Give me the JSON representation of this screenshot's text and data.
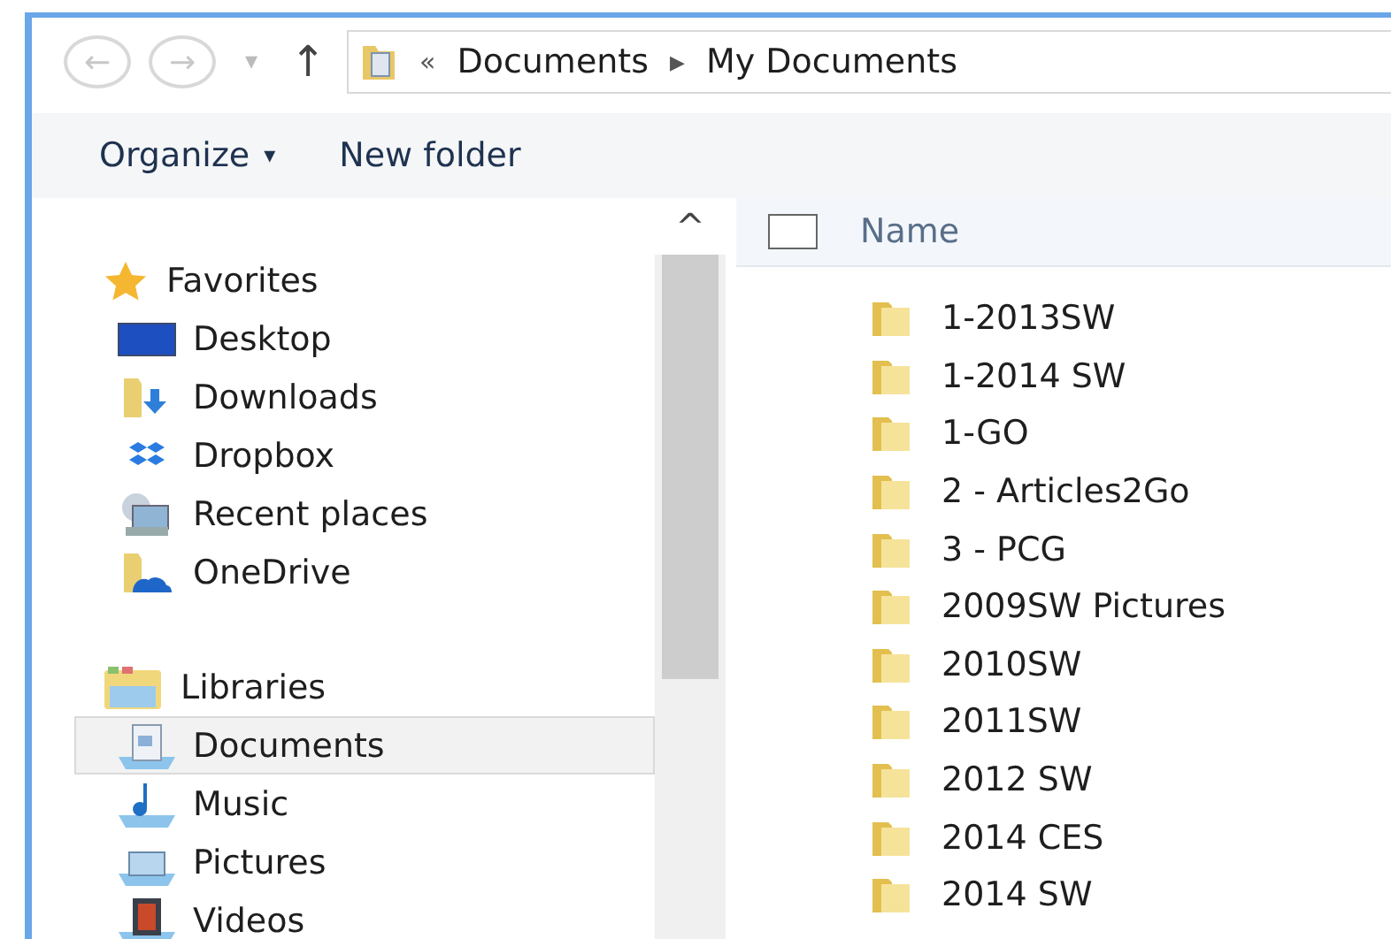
{
  "navigation": {
    "back": {
      "label": "←",
      "disabled": true
    },
    "forward": {
      "label": "→",
      "disabled": true
    },
    "recent": {
      "label": "▾"
    },
    "up": {
      "label": "↑"
    }
  },
  "address": {
    "separator": "«",
    "crumbs": [
      {
        "label": "Documents",
        "arrow": "▶"
      },
      {
        "label": "My Documents"
      }
    ]
  },
  "toolbar": [
    {
      "label": "Organize",
      "caret": "▾"
    },
    {
      "label": "New folder"
    }
  ],
  "sidebar": [
    {
      "label": "Favorites",
      "children": [
        {
          "label": "Desktop",
          "selected": false
        },
        {
          "label": "Downloads",
          "selected": false
        },
        {
          "label": "Dropbox",
          "selected": false
        },
        {
          "label": "Recent places",
          "selected": false
        },
        {
          "label": "OneDrive",
          "selected": false
        }
      ]
    },
    {
      "label": "Libraries",
      "children": [
        {
          "label": "Documents",
          "selected": true
        },
        {
          "label": "Music",
          "selected": false
        },
        {
          "label": "Pictures",
          "selected": false
        },
        {
          "label": "Videos",
          "selected": false
        }
      ]
    }
  ],
  "scrollbar": {
    "up": "^"
  },
  "file_list": {
    "columns": [
      {
        "label": "Name",
        "checked": false
      }
    ],
    "rows": [
      {
        "name": "1-2013SW"
      },
      {
        "name": "1-2014 SW"
      },
      {
        "name": "1-GO"
      },
      {
        "name": "2 - Articles2Go"
      },
      {
        "name": "3 - PCG"
      },
      {
        "name": "2009SW Pictures"
      },
      {
        "name": "2010SW"
      },
      {
        "name": "2011SW"
      },
      {
        "name": "2012 SW"
      },
      {
        "name": "2014 CES"
      },
      {
        "name": "2014 SW"
      }
    ]
  }
}
